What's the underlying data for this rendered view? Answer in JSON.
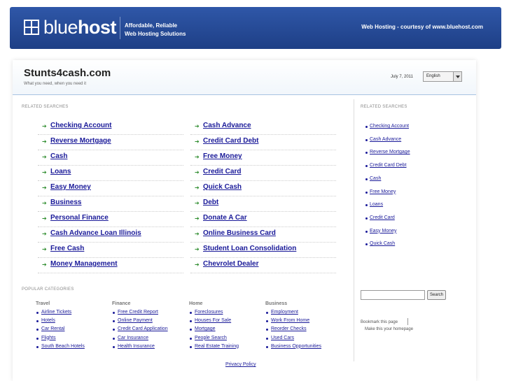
{
  "header": {
    "logo_light": "blue",
    "logo_bold": "host",
    "tagline_1": "Affordable, Reliable",
    "tagline_2": "Web Hosting Solutions",
    "courtesy": "Web Hosting - courtesy of www.bluehost.com"
  },
  "site": {
    "title": "Stunts4cash.com",
    "subtitle": "What you need, when you need it",
    "date": "July 7, 2011",
    "language": "English"
  },
  "related": {
    "label": "RELATED SEARCHES",
    "left": [
      "Checking Account",
      "Reverse Mortgage",
      "Cash",
      "Loans",
      "Easy Money",
      "Business",
      "Personal Finance",
      "Cash Advance Loan Illinois",
      "Free Cash",
      "Money Management"
    ],
    "right": [
      "Cash Advance",
      "Credit Card Debt",
      "Free Money",
      "Credit Card",
      "Quick Cash",
      "Debt",
      "Donate A Car",
      "Online Business Card",
      "Student Loan Consolidation",
      "Chevrolet Dealer"
    ]
  },
  "sidebar": {
    "label": "RELATED SEARCHES",
    "items": [
      "Checking Account",
      "Cash Advance",
      "Reverse Mortgage",
      "Credit Card Debt",
      "Cash",
      "Free Money",
      "Loans",
      "Credit Card",
      "Easy Money",
      "Quick Cash"
    ],
    "search_button": "Search",
    "bookmark": "Bookmark this page",
    "homepage": "Make this your homepage"
  },
  "popular": {
    "label": "POPULAR CATEGORIES",
    "columns": [
      {
        "title": "Travel",
        "items": [
          "Airline Tickets",
          "Hotels",
          "Car Rental",
          "Flights",
          "South Beach Hotels"
        ]
      },
      {
        "title": "Finance",
        "items": [
          "Free Credit Report",
          "Online Payment",
          "Credit Card Application",
          "Car Insurance",
          "Health Insurance"
        ]
      },
      {
        "title": "Home",
        "items": [
          "Foreclosures",
          "Houses For Sale",
          "Mortgage",
          "People Search",
          "Real Estate Training"
        ]
      },
      {
        "title": "Business",
        "items": [
          "Employment",
          "Work From Home",
          "Reorder Checks",
          "Used Cars",
          "Business Opportunities"
        ]
      }
    ]
  },
  "footer": {
    "privacy": "Privacy Policy"
  },
  "colors": {
    "banner": "#2f57a8",
    "link": "#1a1a99",
    "bullet": "#2a8a2a"
  }
}
